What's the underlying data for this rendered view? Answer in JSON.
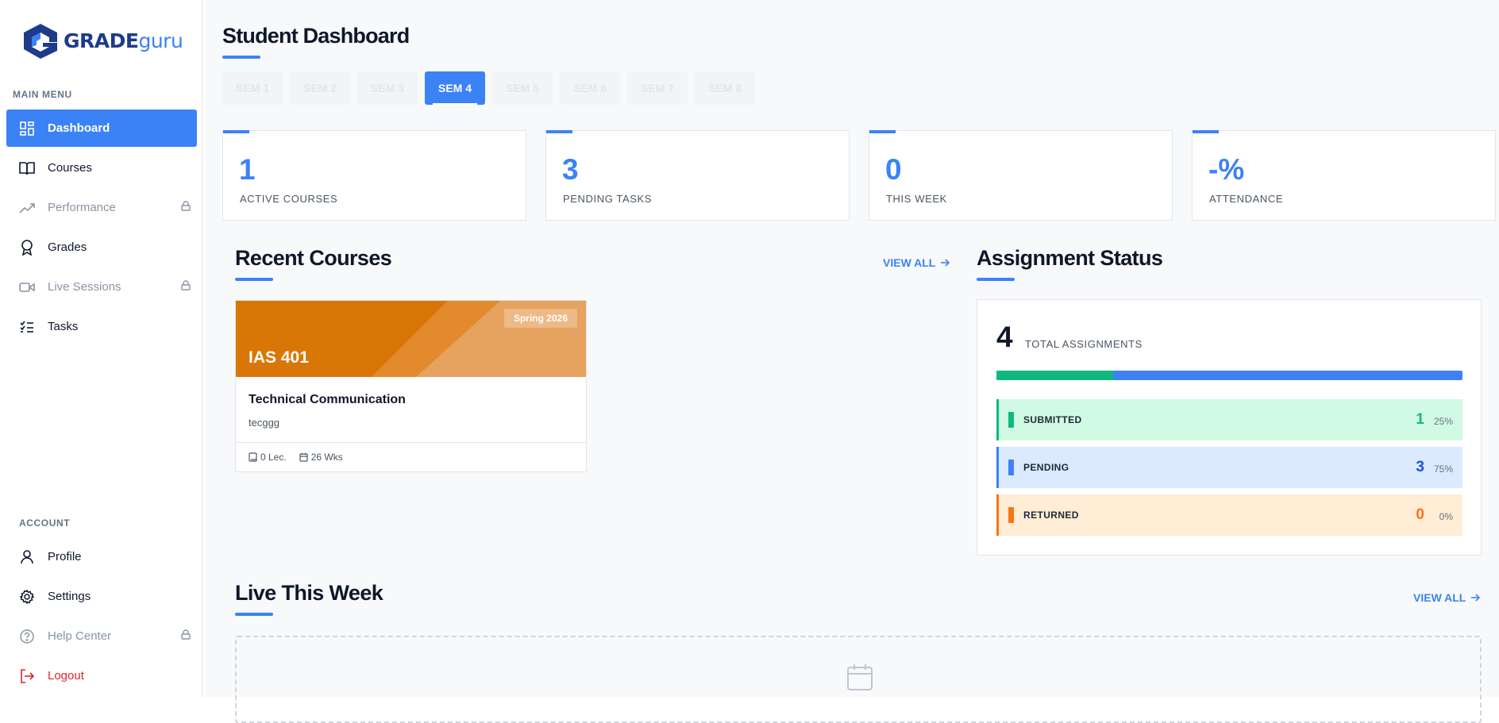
{
  "brand": {
    "name_bold": "GRADE",
    "name_light": "guru"
  },
  "sidebar": {
    "main_menu_heading": "MAIN MENU",
    "items": [
      {
        "label": "Dashboard",
        "icon": "dashboard-icon",
        "state": "active"
      },
      {
        "label": "Courses",
        "icon": "book-icon",
        "state": "normal"
      },
      {
        "label": "Performance",
        "icon": "trending-up-icon",
        "state": "locked"
      },
      {
        "label": "Grades",
        "icon": "award-icon",
        "state": "normal"
      },
      {
        "label": "Live Sessions",
        "icon": "video-icon",
        "state": "locked"
      },
      {
        "label": "Tasks",
        "icon": "checklist-icon",
        "state": "normal"
      }
    ],
    "account_heading": "ACCOUNT",
    "account_items": [
      {
        "label": "Profile",
        "icon": "user-icon",
        "state": "normal"
      },
      {
        "label": "Settings",
        "icon": "gear-icon",
        "state": "normal"
      },
      {
        "label": "Help Center",
        "icon": "help-icon",
        "state": "locked"
      },
      {
        "label": "Logout",
        "icon": "logout-icon",
        "state": "danger"
      }
    ]
  },
  "page": {
    "title": "Student Dashboard"
  },
  "semesters": {
    "tabs": [
      "SEM 1",
      "SEM 2",
      "SEM 3",
      "SEM 4",
      "SEM 5",
      "SEM 6",
      "SEM 7",
      "SEM 8"
    ],
    "active": "SEM 4"
  },
  "stats": [
    {
      "value": "1",
      "label": "ACTIVE COURSES"
    },
    {
      "value": "3",
      "label": "PENDING TASKS"
    },
    {
      "value": "0",
      "label": "THIS WEEK"
    },
    {
      "value": "-%",
      "label": "ATTENDANCE"
    }
  ],
  "recent_courses": {
    "title": "Recent Courses",
    "view_all": "VIEW ALL",
    "courses": [
      {
        "term": "Spring 2026",
        "code": "IAS 401",
        "name": "Technical Communication",
        "instructor": "tecggg",
        "lectures": "0 Lec.",
        "weeks": "26 Wks",
        "color": "#d97706"
      }
    ]
  },
  "assignment_status": {
    "title": "Assignment Status",
    "total": "4",
    "total_label": "TOTAL ASSIGNMENTS",
    "submitted_fraction": 0.25,
    "rows": [
      {
        "label": "SUBMITTED",
        "count": "1",
        "pct": "25%",
        "color": "#10b981"
      },
      {
        "label": "PENDING",
        "count": "3",
        "pct": "75%",
        "color": "#3b82f6"
      },
      {
        "label": "RETURNED",
        "count": "0",
        "pct": "0%",
        "color": "#f97316"
      }
    ]
  },
  "live_this_week": {
    "title": "Live This Week",
    "view_all": "VIEW ALL"
  },
  "colors": {
    "accent": "#3b82f6",
    "brand_dark": "#1e3a8a",
    "danger": "#dc2626"
  }
}
